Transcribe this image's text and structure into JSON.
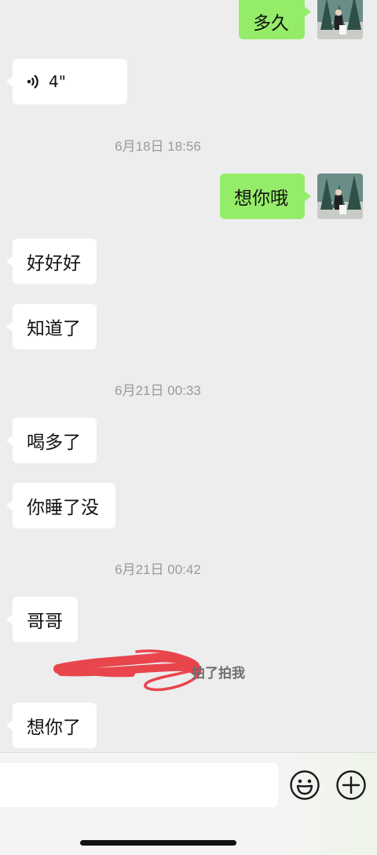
{
  "messages": {
    "m0": {
      "text": "多久"
    },
    "m1": {
      "duration": "4\""
    },
    "t1": "6月18日 18:56",
    "m2": {
      "text": "想你哦"
    },
    "m3": {
      "text": "好好好"
    },
    "m4": {
      "text": "知道了"
    },
    "t2": "6月21日 00:33",
    "m5": {
      "text": "喝多了"
    },
    "m6": {
      "text": "你睡了没"
    },
    "t3": "6月21日 00:42",
    "m7": {
      "text": "哥哥"
    },
    "pat": {
      "text": "拍了拍我"
    },
    "m8": {
      "text": "想你了"
    }
  },
  "input": {
    "value": "",
    "placeholder": ""
  },
  "icons": {
    "voice": "voice-wave-icon",
    "emoji": "emoji-face-icon",
    "plus": "plus-circle-icon"
  },
  "colors": {
    "background": "#ededed",
    "outgoing_bubble": "#95ec69",
    "incoming_bubble": "#ffffff",
    "redaction_scribble": "#e8454d"
  }
}
